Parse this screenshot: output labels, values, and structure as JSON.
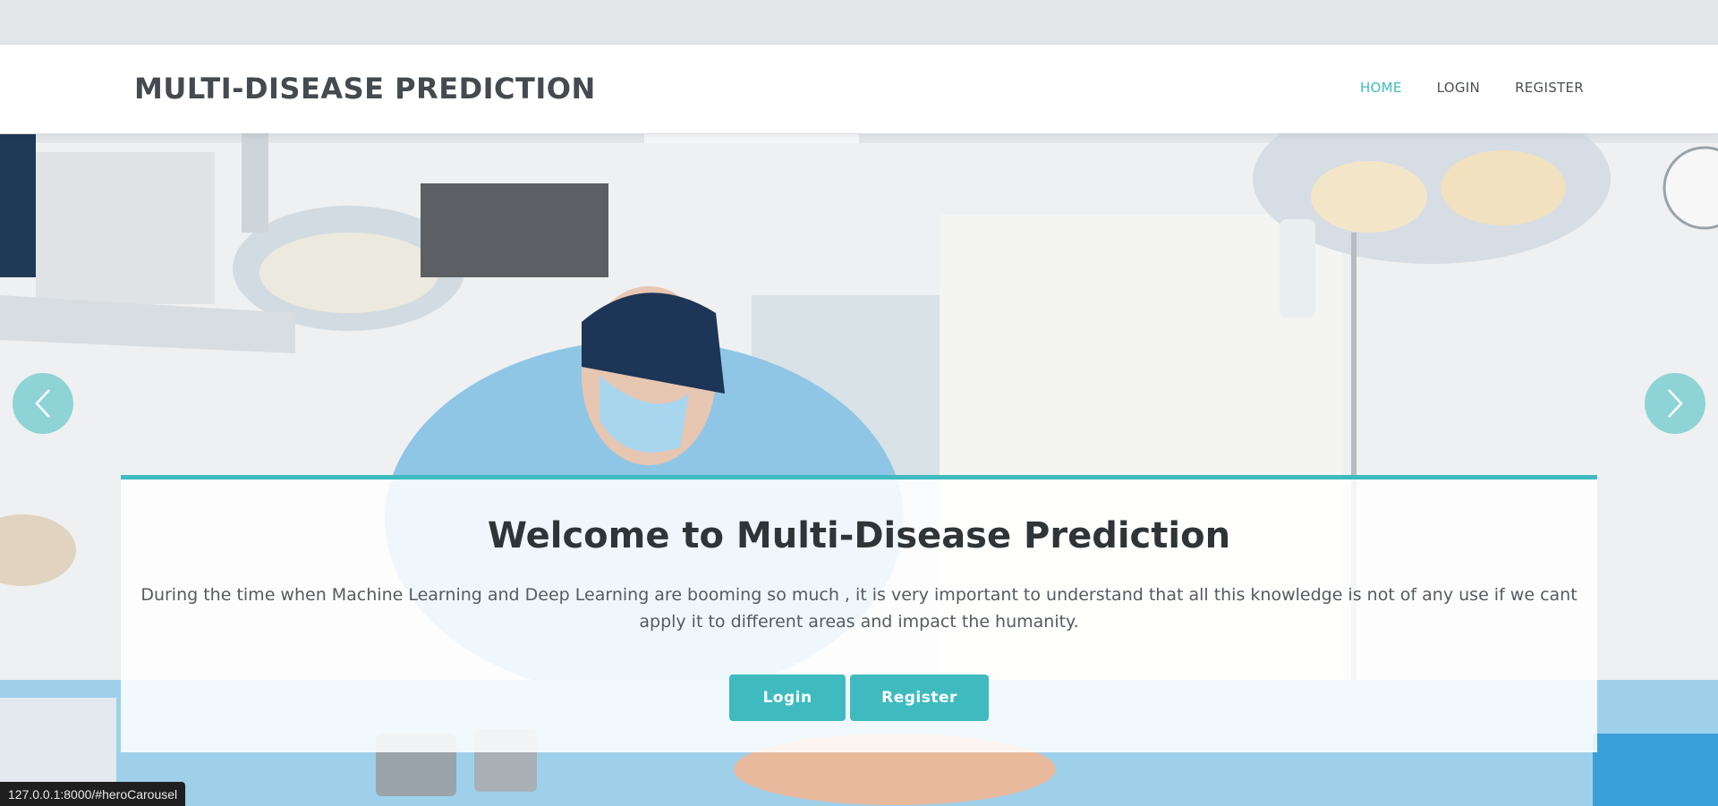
{
  "header": {
    "logo": "MULTI-DISEASE PREDICTION",
    "nav": [
      {
        "label": "HOME",
        "active": true
      },
      {
        "label": "LOGIN",
        "active": false
      },
      {
        "label": "REGISTER",
        "active": false
      }
    ]
  },
  "hero": {
    "title": "Welcome to Multi-Disease Prediction",
    "description": "During the time when Machine Learning and Deep Learning are booming so much , it is very important to understand that all this knowledge is not of any use if we cant apply it to different areas and impact the humanity.",
    "buttons": {
      "login": "Login",
      "register": "Register"
    }
  },
  "status_bar": {
    "url": "127.0.0.1:8000/#heroCarousel"
  },
  "colors": {
    "accent": "#3fbbc0",
    "text_dark": "#2f3437"
  },
  "icons": {
    "prev": "chevron-left-icon",
    "next": "chevron-right-icon"
  }
}
